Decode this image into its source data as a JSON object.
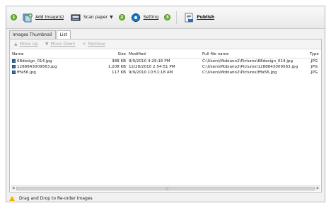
{
  "toolbar": {
    "step1": "1",
    "add_images_label": "Add Image(s)",
    "scan_paper_label": "Scan paper",
    "scan_dropdown": "▼",
    "step2": "2",
    "setting_label": "Setting",
    "step3": "3",
    "publish_label": "Publish"
  },
  "tabs": [
    {
      "label": "Images Thumbnail"
    },
    {
      "label": "List"
    }
  ],
  "list_toolbar": {
    "move_up": "Move Up",
    "move_down": "Move Down",
    "remove": "Remove"
  },
  "columns": {
    "name": "Name",
    "size": "Size",
    "modified": "Modified",
    "full_name": "Full file name",
    "type": "Type"
  },
  "rows": [
    {
      "name": "68design_014.jpg",
      "size": "388 KB",
      "modified": "9/9/2010 4:29:16 PM",
      "full": "C:\\Users\\Mobiano2\\Pictures\\68design_014.jpg",
      "type": ".JPG"
    },
    {
      "name": "1288843009563.jpg",
      "size": "1,208 KB",
      "modified": "12/28/2010 2:54:51 PM",
      "full": "C:\\Users\\Mobiano2\\Pictures\\1288843009563.jpg",
      "type": ".JPG"
    },
    {
      "name": "fffa56.jpg",
      "size": "117 KB",
      "modified": "9/9/2010 10:51:18 AM",
      "full": "C:\\Users\\Mobiano2\\Pictures\\fffa56.jpg",
      "type": ".JPG"
    }
  ],
  "scrollbar": {
    "left": "◄",
    "grip": "|||",
    "right": "►"
  },
  "status": {
    "text": "Drag and Drop to Re-order Images",
    "icon": "warning-icon"
  },
  "colors": {
    "step_green": "#6bb32e",
    "warning": "#f0b400",
    "file_icon": "#3a6ea5"
  }
}
